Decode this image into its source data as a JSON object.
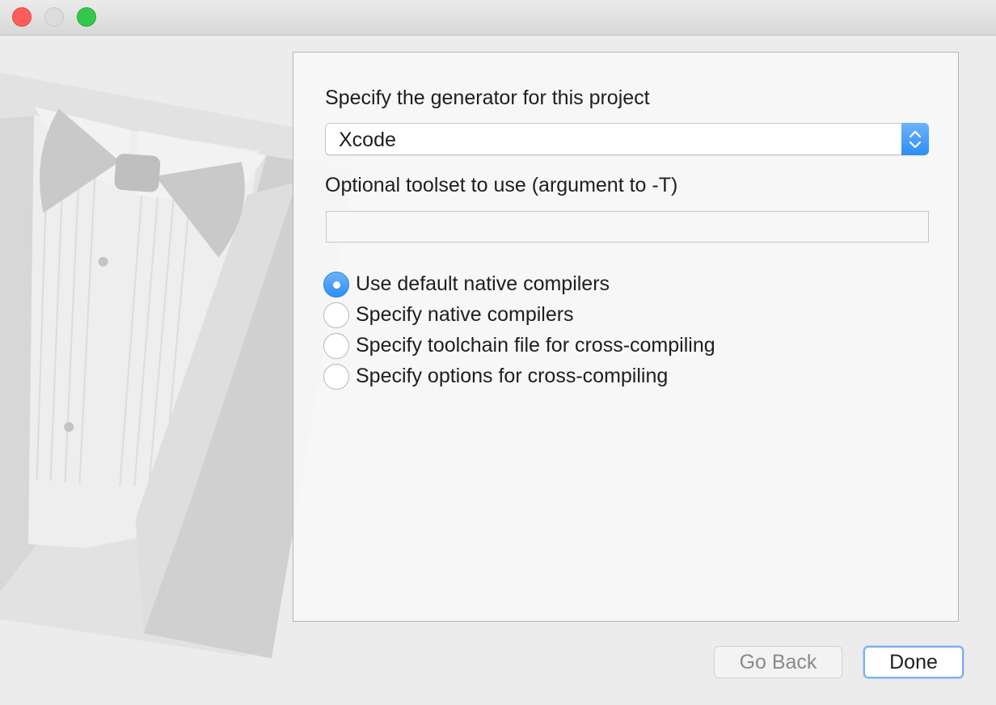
{
  "window": {
    "controls": [
      "close-icon",
      "minimize-icon",
      "zoom-icon"
    ]
  },
  "panel": {
    "generator_label": "Specify the generator for this project",
    "generator_select": {
      "value": "Xcode",
      "icon": "up-down-chevron-icon"
    },
    "toolset_label": "Optional toolset to use (argument to -T)",
    "toolset_value": "",
    "compiler_options": [
      {
        "label": "Use default native compilers",
        "selected": true
      },
      {
        "label": "Specify native compilers",
        "selected": false
      },
      {
        "label": "Specify toolchain file for cross-compiling",
        "selected": false
      },
      {
        "label": "Specify options for cross-compiling",
        "selected": false
      }
    ]
  },
  "buttons": {
    "back_label": "Go Back",
    "done_label": "Done"
  },
  "colors": {
    "accent": "#3a93f6",
    "close": "#fc5f57",
    "zoom": "#34c84a"
  }
}
